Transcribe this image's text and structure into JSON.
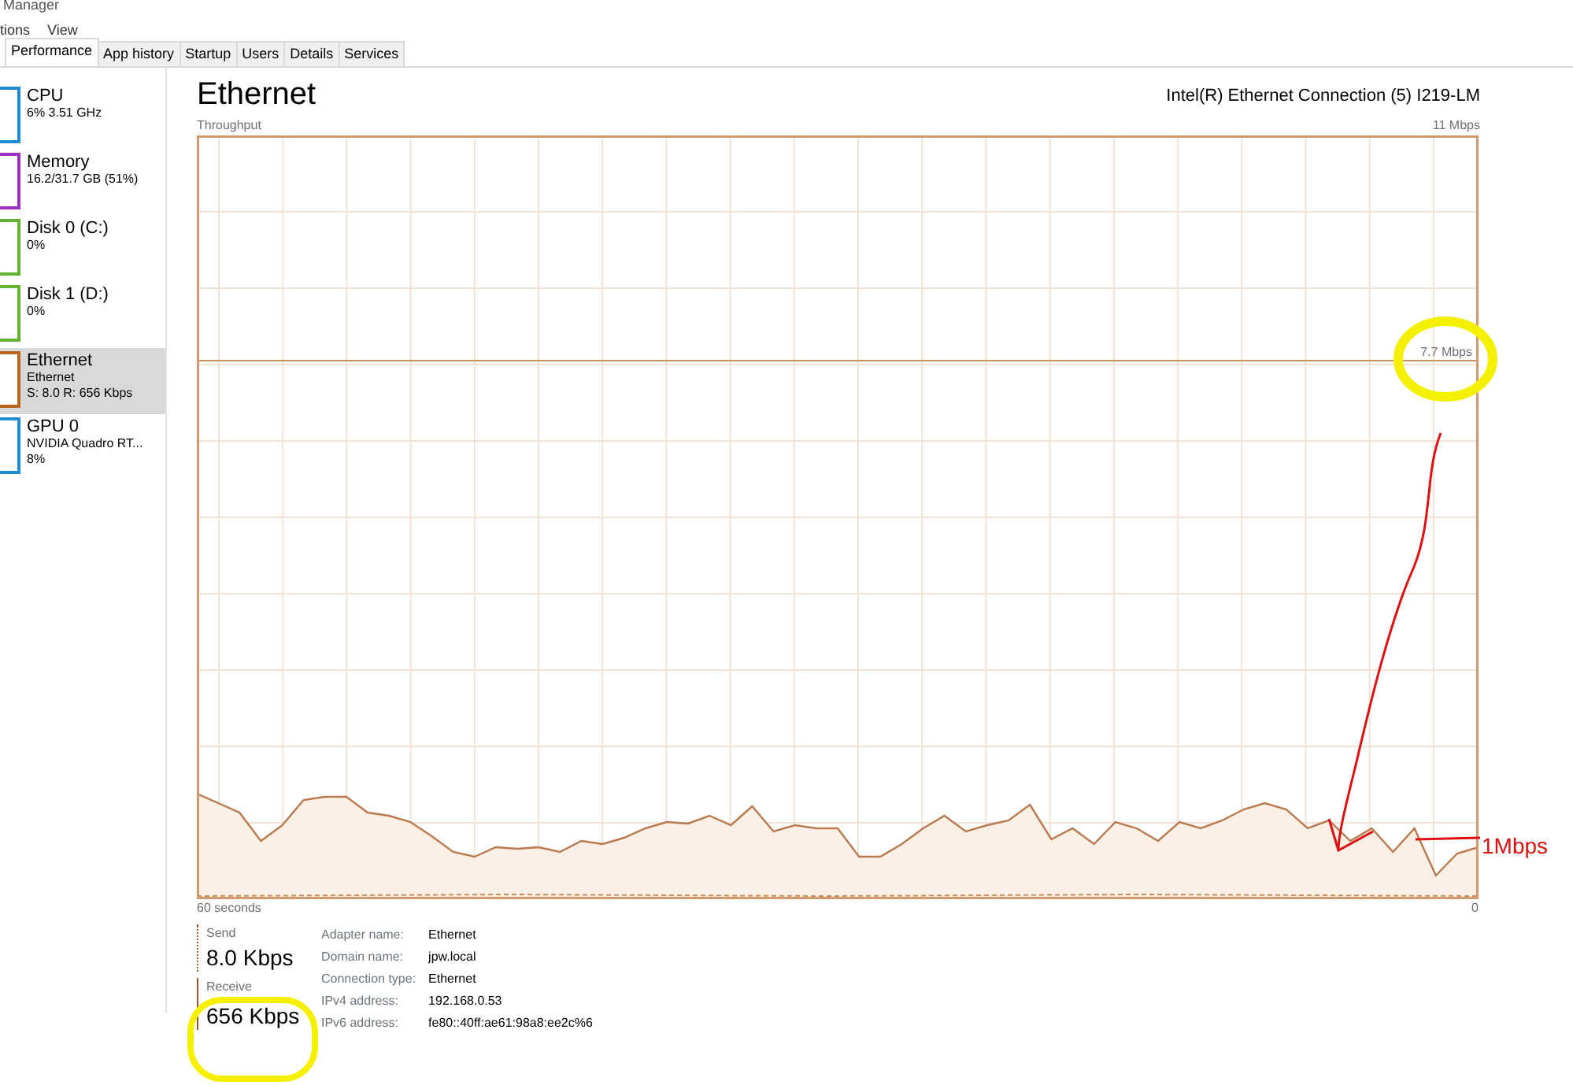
{
  "window": {
    "title": "Manager"
  },
  "menu": [
    {
      "label": "tions"
    },
    {
      "label": "View"
    }
  ],
  "tabs": [
    {
      "label": "Performance",
      "selected": true
    },
    {
      "label": "App history",
      "selected": false
    },
    {
      "label": "Startup",
      "selected": false
    },
    {
      "label": "Users",
      "selected": false
    },
    {
      "label": "Details",
      "selected": false
    },
    {
      "label": "Services",
      "selected": false
    }
  ],
  "sidebar": {
    "items": [
      {
        "name": "CPU",
        "details": [
          "6% 3.51 GHz"
        ],
        "color": "#1e8bd2",
        "selected": false
      },
      {
        "name": "Memory",
        "details": [
          "16.2/31.7 GB (51%)"
        ],
        "color": "#9b2fbf",
        "selected": false
      },
      {
        "name": "Disk 0 (C:)",
        "details": [
          "0%"
        ],
        "color": "#62b32f",
        "selected": false
      },
      {
        "name": "Disk 1 (D:)",
        "details": [
          "0%"
        ],
        "color": "#62b32f",
        "selected": false
      },
      {
        "name": "Ethernet",
        "details": [
          "Ethernet",
          "S: 8.0 R: 656 Kbps"
        ],
        "color": "#b5651d",
        "selected": true
      },
      {
        "name": "GPU 0",
        "details": [
          "NVIDIA Quadro RT...",
          "8%"
        ],
        "color": "#1e8bd2",
        "selected": false
      }
    ]
  },
  "panel": {
    "title": "Ethernet",
    "device": "Intel(R) Ethernet Connection (5) I219-LM",
    "chart": {
      "label": "Throughput",
      "max_label": "11 Mbps",
      "reference_label": "7.7 Mbps",
      "time_label": "60 seconds",
      "min_label": "0"
    },
    "send": {
      "label": "Send",
      "value": "8.0 Kbps"
    },
    "receive": {
      "label": "Receive",
      "value": "656 Kbps"
    },
    "properties": [
      {
        "label": "Adapter name:",
        "value": "Ethernet"
      },
      {
        "label": "Domain name:",
        "value": "jpw.local"
      },
      {
        "label": "Connection type:",
        "value": "Ethernet"
      },
      {
        "label": "IPv4 address:",
        "value": "192.168.0.53"
      },
      {
        "label": "IPv6 address:",
        "value": "fe80::40ff:ae61:98a8:ee2c%6"
      }
    ]
  },
  "annotations": {
    "note": "1Mbps"
  }
}
